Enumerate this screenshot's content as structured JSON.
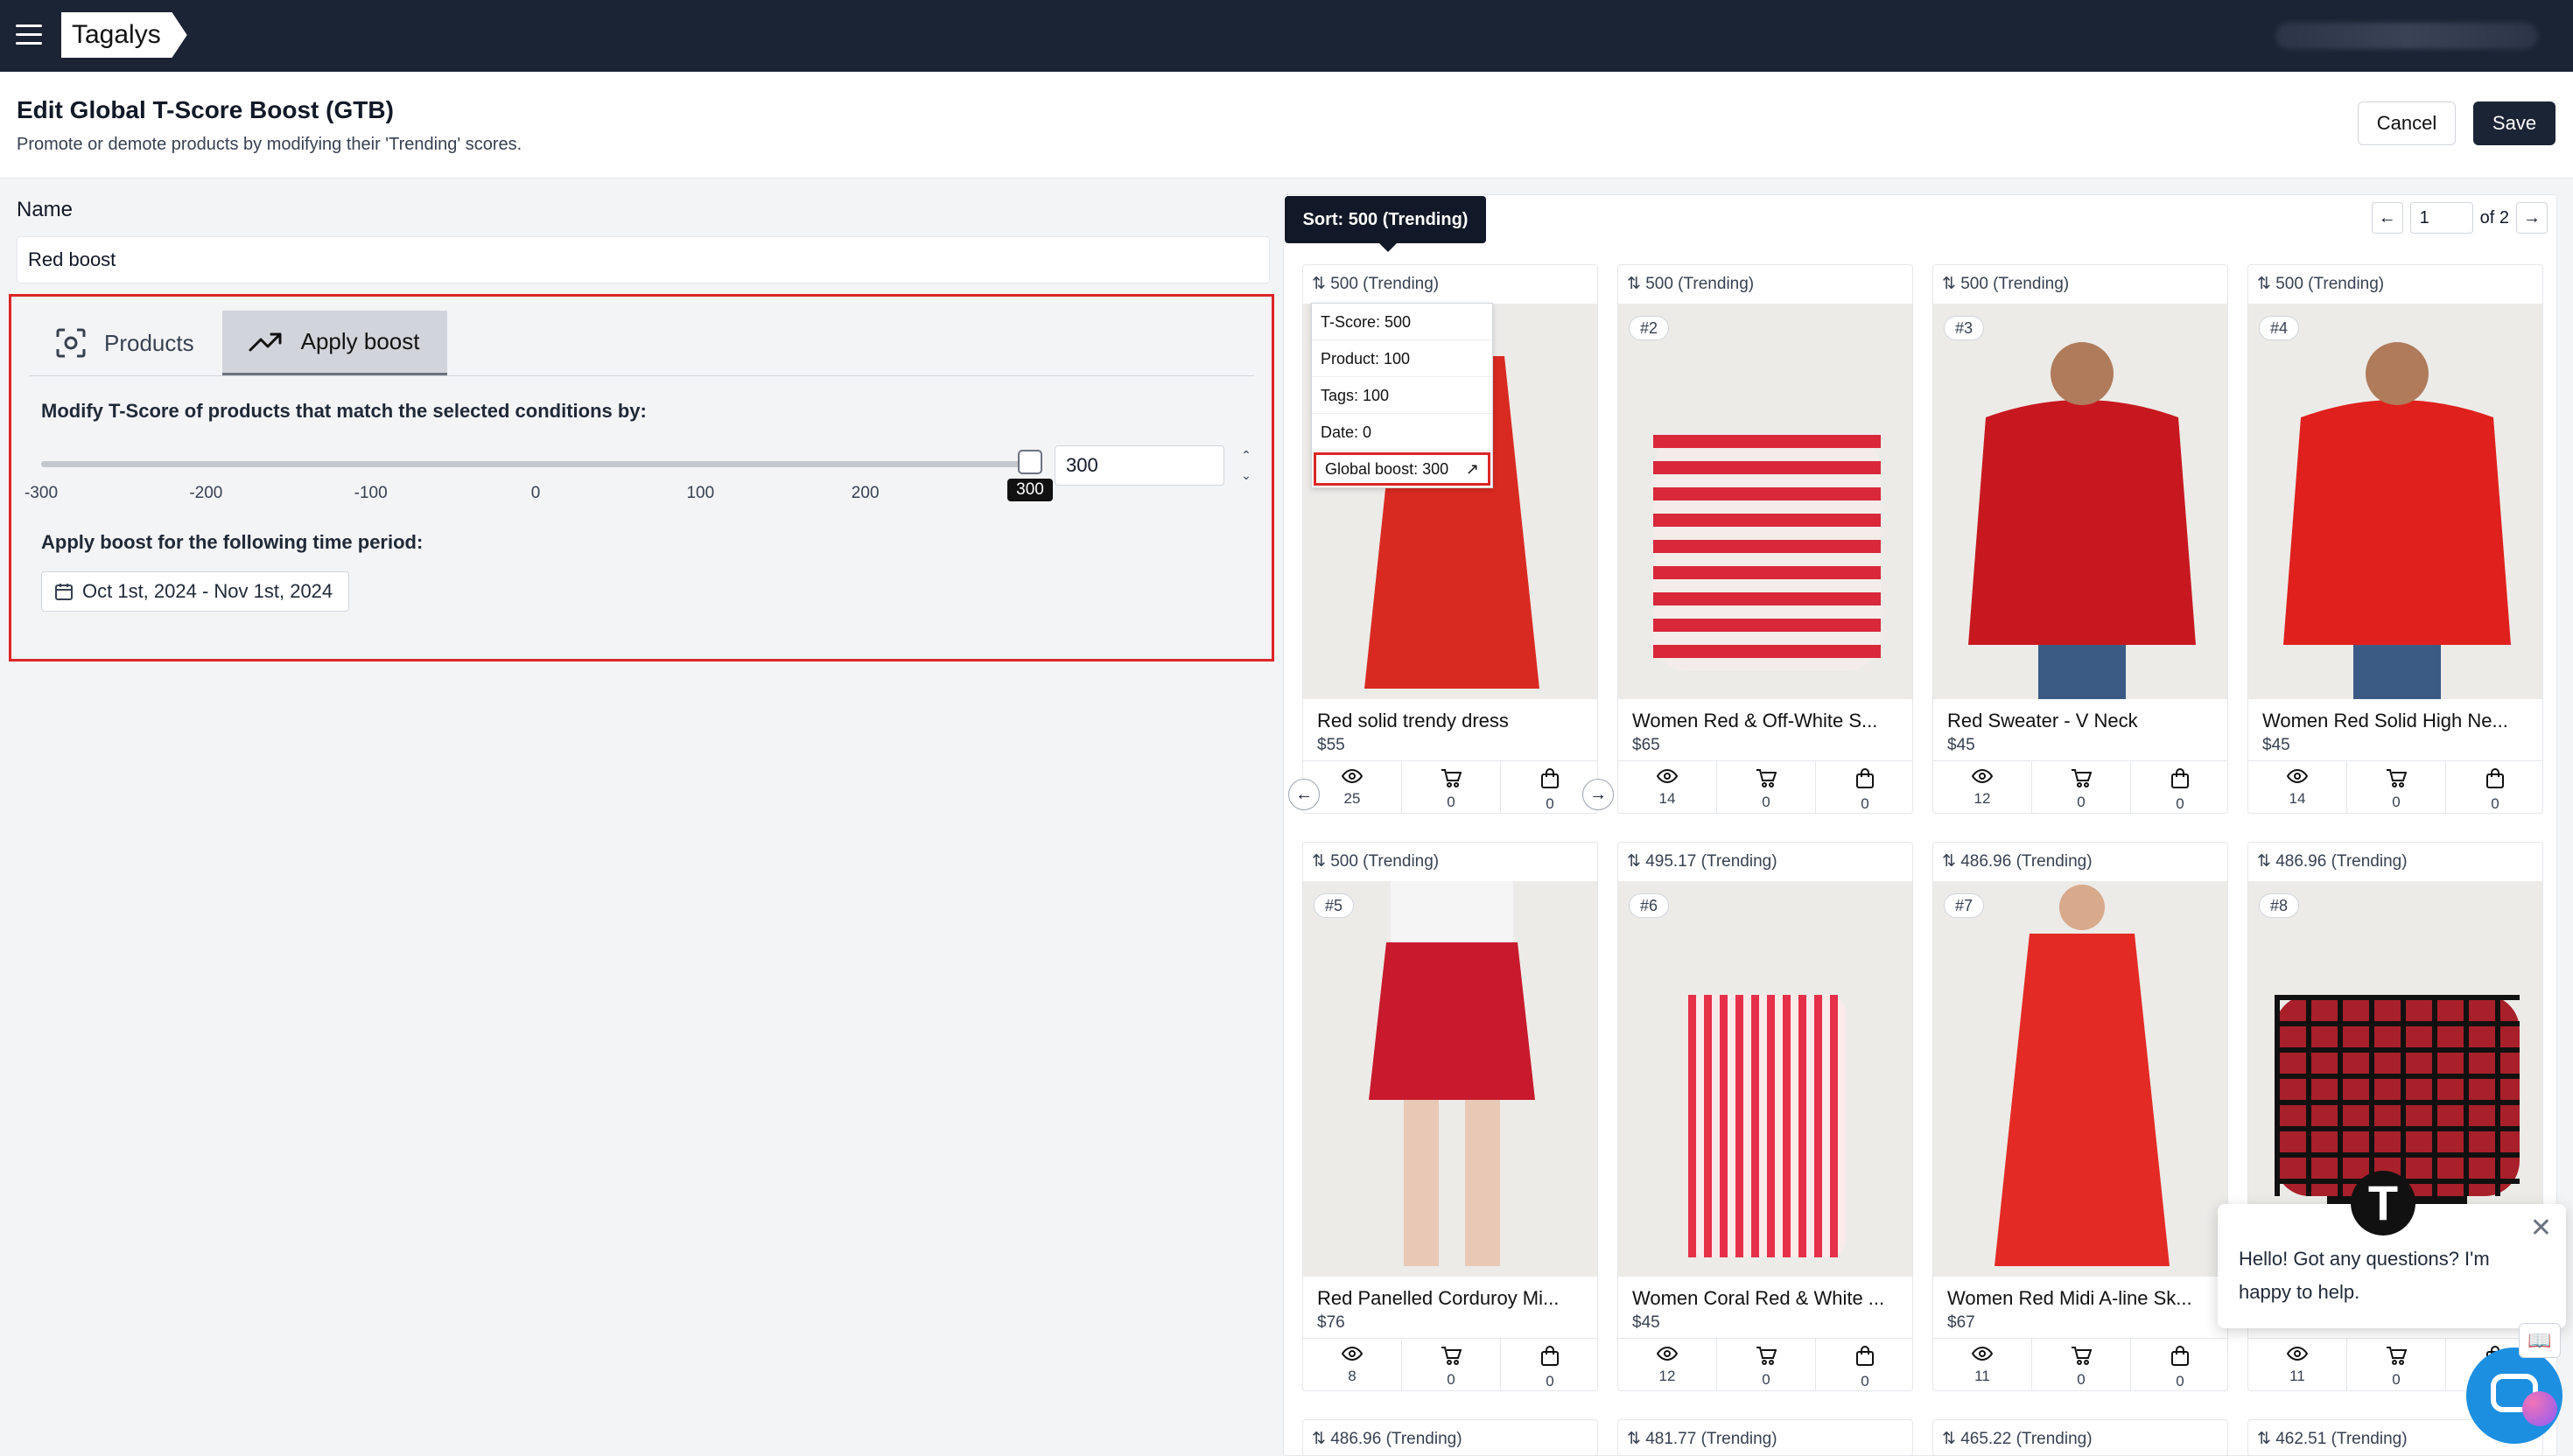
{
  "app": {
    "logo": "Tagalys"
  },
  "header": {
    "title": "Edit Global T-Score Boost (GTB)",
    "subtitle": "Promote or demote products by modifying their 'Trending' scores.",
    "cancel_label": "Cancel",
    "save_label": "Save"
  },
  "form": {
    "name_label": "Name",
    "name_value": "Red boost",
    "tabs": [
      {
        "label": "Products",
        "icon": "focus-icon",
        "active": false
      },
      {
        "label": "Apply boost",
        "icon": "trending-up-icon",
        "active": true
      }
    ],
    "modify_label": "Modify T-Score of products that match the selected conditions by:",
    "slider": {
      "min": -300,
      "max": 300,
      "value": 300,
      "value_label": "300",
      "ticks": [
        "-300",
        "-200",
        "-100",
        "0",
        "100",
        "200",
        "300"
      ]
    },
    "boost_value": "300",
    "period_label": "Apply boost for the following time period:",
    "date_range": "Oct 1st, 2024 - Nov 1st, 2024"
  },
  "results": {
    "sort_tooltip": "Sort: 500 (Trending)",
    "page": "1",
    "of_label": "of 2",
    "breakdown": {
      "tscore": "T-Score: 500",
      "product": "Product: 100",
      "tags": "Tags: 100",
      "date": "Date: 0",
      "global_boost": "Global boost: 300"
    },
    "products": [
      {
        "score": "500 (Trending)",
        "badge": "",
        "name": "Red solid trendy dress",
        "price": "$55",
        "views": "25",
        "carts": "0",
        "orders": "0",
        "color": "#d92a22",
        "style": "dress"
      },
      {
        "score": "500 (Trending)",
        "badge": "#2",
        "name": "Women Red & Off-White S...",
        "price": "$65",
        "views": "14",
        "carts": "0",
        "orders": "0",
        "color": "#d8283a",
        "style": "stripe"
      },
      {
        "score": "500 (Trending)",
        "badge": "#3",
        "name": "Red Sweater - V Neck",
        "price": "$45",
        "views": "12",
        "carts": "0",
        "orders": "0",
        "color": "#c8181f",
        "style": "sweater"
      },
      {
        "score": "500 (Trending)",
        "badge": "#4",
        "name": "Women Red Solid High Ne...",
        "price": "$45",
        "views": "14",
        "carts": "0",
        "orders": "0",
        "color": "#e0201c",
        "style": "sweater"
      },
      {
        "score": "500 (Trending)",
        "badge": "#5",
        "name": "Red Panelled Corduroy Mi...",
        "price": "$76",
        "views": "8",
        "carts": "0",
        "orders": "0",
        "color": "#c81a2c",
        "style": "skirt"
      },
      {
        "score": "495.17 (Trending)",
        "badge": "#6",
        "name": "Women Coral Red & White ...",
        "price": "$45",
        "views": "12",
        "carts": "0",
        "orders": "0",
        "color": "#e6304a",
        "style": "vstripe"
      },
      {
        "score": "486.96 (Trending)",
        "badge": "#7",
        "name": "Women Red Midi A-line Sk...",
        "price": "$67",
        "views": "11",
        "carts": "0",
        "orders": "0",
        "color": "#e42a24",
        "style": "dress"
      },
      {
        "score": "486.96 (Trending)",
        "badge": "#8",
        "name": "",
        "price": "",
        "views": "11",
        "carts": "0",
        "orders": "0",
        "color": "#a8202a",
        "style": "plaid"
      }
    ],
    "next_row_scores": [
      "486.96 (Trending)",
      "481.77 (Trending)",
      "465.22 (Trending)",
      "462.51 (Trending)"
    ]
  },
  "chat": {
    "message": "Hello! Got any questions? I'm happy to help.",
    "avatar_letter": "T"
  }
}
